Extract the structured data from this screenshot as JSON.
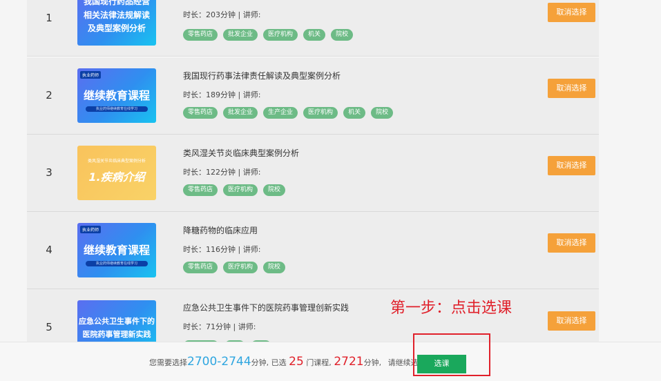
{
  "courses": [
    {
      "index": "1",
      "thumb_text": "我国现行药品经营相关法律法规解读及典型案例分析",
      "thumb_lines": [
        "我国现行药品经营",
        "相关法律法规解读",
        "及典型案例分析"
      ],
      "title": "",
      "meta": "时长：203分钟 | 讲师:",
      "tags": [
        "零售药店",
        "批发企业",
        "医疗机构",
        "机关",
        "院校"
      ],
      "action": "取消选择"
    },
    {
      "index": "2",
      "thumb_tag": "执业药师",
      "thumb_title": "继续教育课程",
      "thumb_sub": "执业药师继续教育在线学习",
      "title": "我国现行药事法律责任解读及典型案例分析",
      "meta": "时长：189分钟 | 讲师:",
      "tags": [
        "零售药店",
        "批发企业",
        "生产企业",
        "医疗机构",
        "机关",
        "院校"
      ],
      "action": "取消选择"
    },
    {
      "index": "3",
      "thumb_caption": "类风湿关节炎临床典型案例分析",
      "thumb_title": "1.疾病介绍",
      "title": "类风湿关节炎临床典型案例分析",
      "meta": "时长：122分钟 | 讲师:",
      "tags": [
        "零售药店",
        "医疗机构",
        "院校"
      ],
      "action": "取消选择"
    },
    {
      "index": "4",
      "thumb_tag": "执业药师",
      "thumb_title": "继续教育课程",
      "thumb_sub": "执业药师继续教育在线学习",
      "title": "降糖药物的临床应用",
      "meta": "时长：116分钟 | 讲师:",
      "tags": [
        "零售药店",
        "医疗机构",
        "院校"
      ],
      "action": "取消选择"
    },
    {
      "index": "5",
      "thumb_lines": [
        "应急公共卫生事件下的",
        "医院药事管理新实践"
      ],
      "title": "应急公共卫生事件下的医院药事管理创新实践",
      "meta": "时长：71分钟 | 讲师:",
      "action": "取消选择"
    }
  ],
  "annotation": "第一步：点击选课",
  "footer": {
    "prefix": "您需要选择",
    "range": "2700-2744",
    "unit1": "分钟, 已选",
    "count": "25",
    "unit2": "门课程,",
    "minutes": "2721",
    "unit3": "分钟,",
    "hint": "请继续选课",
    "select_label": "选课"
  },
  "colors": {
    "accent_orange": "#f5a13a",
    "tag_green": "#6dbb86",
    "select_green": "#1aa85c",
    "highlight_red": "#e0202a",
    "range_blue": "#2fa6e0"
  }
}
